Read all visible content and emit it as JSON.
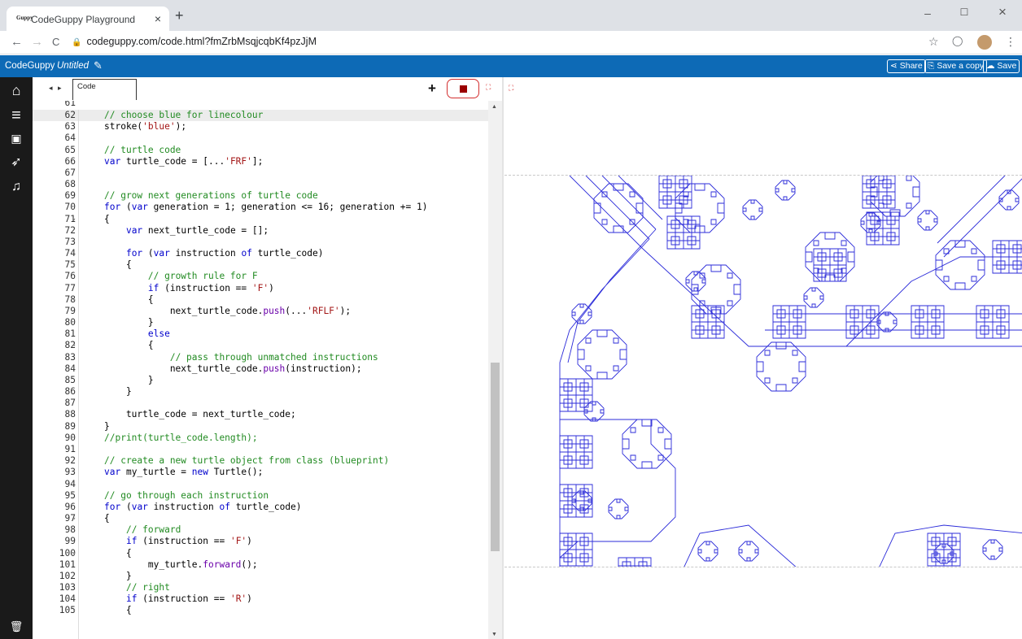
{
  "browser": {
    "tab_title": "CodeGuppy Playground",
    "favicon_text": "Guppy",
    "tab_close": "×",
    "new_tab": "+",
    "minimize": "–",
    "maximize": "☐",
    "close": "×",
    "back": "←",
    "forward": "→",
    "reload": "C",
    "url": "codeguppy.com/code.html?fmZrbMsqjcqbKf4pzJjM",
    "star": "☆",
    "menu": "⋮"
  },
  "app": {
    "brand": "CodeGuppy",
    "project_name": "Untitled",
    "buttons": {
      "share": "Share",
      "save_copy": "Save a copy",
      "save": "Save"
    }
  },
  "sidebar": {
    "home": "⌂",
    "menu": "≡",
    "image": "▣",
    "rocket": "➶",
    "music": "♫",
    "trash": "🗑"
  },
  "editor": {
    "tab_label": "Code",
    "arrows": "◂ ▸",
    "add": "+"
  },
  "colors": {
    "app_bar": "#0d6ab6",
    "stop": "#9b0000",
    "turtle": "#2b2bd9"
  }
}
